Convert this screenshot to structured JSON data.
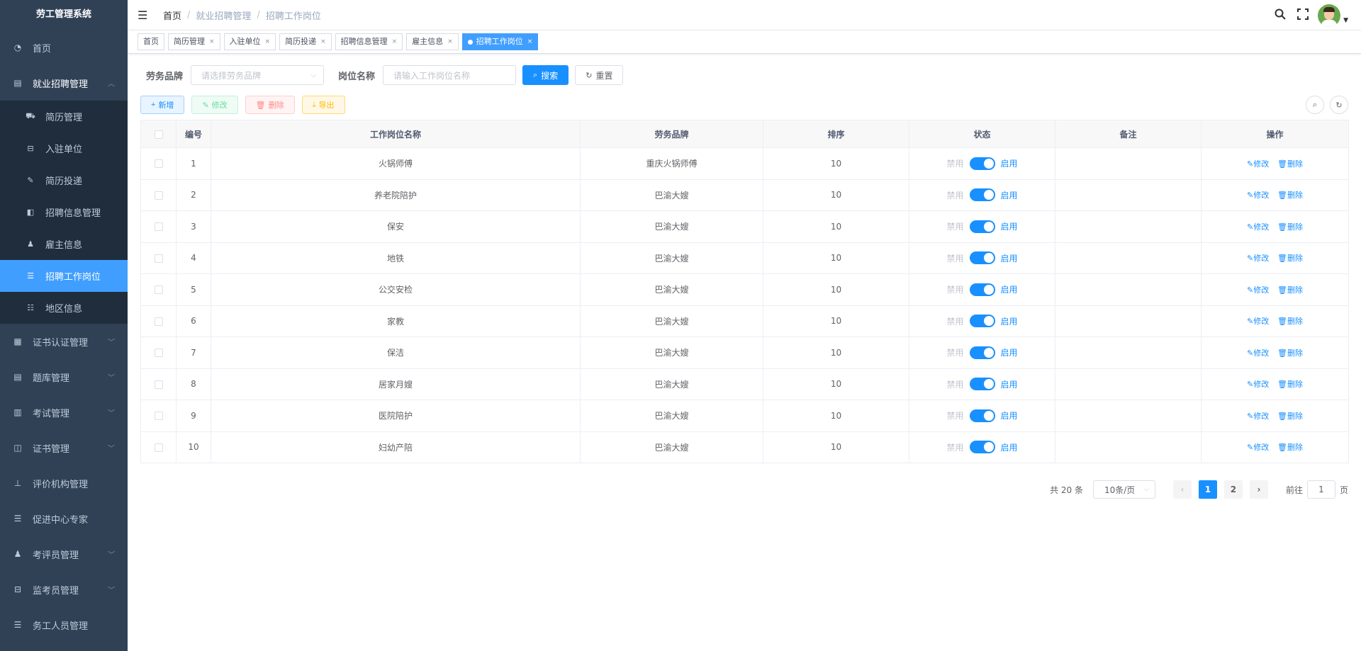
{
  "app": {
    "title": "劳工管理系统"
  },
  "sidebar": {
    "items": [
      {
        "label": "首页",
        "icon": "dashboard-icon",
        "glyph": "◔"
      },
      {
        "label": "就业招聘管理",
        "icon": "document-icon",
        "glyph": "▤",
        "open": true,
        "children": [
          {
            "label": "简历管理",
            "icon": "cart-icon",
            "glyph": "⛟"
          },
          {
            "label": "入驻单位",
            "icon": "building-icon",
            "glyph": "⊟"
          },
          {
            "label": "简历投递",
            "icon": "edit-doc-icon",
            "glyph": "✎"
          },
          {
            "label": "招聘信息管理",
            "icon": "info-icon",
            "glyph": "◧"
          },
          {
            "label": "雇主信息",
            "icon": "people-icon",
            "glyph": "♟"
          },
          {
            "label": "招聘工作岗位",
            "icon": "list-icon",
            "glyph": "☰",
            "active": true
          },
          {
            "label": "地区信息",
            "icon": "tree-list-icon",
            "glyph": "☷"
          }
        ]
      },
      {
        "label": "证书认证管理",
        "icon": "cert-icon",
        "glyph": "▦",
        "arrow": true
      },
      {
        "label": "题库管理",
        "icon": "question-bank-icon",
        "glyph": "▤",
        "arrow": true
      },
      {
        "label": "考试管理",
        "icon": "exam-icon",
        "glyph": "▥",
        "arrow": true
      },
      {
        "label": "证书管理",
        "icon": "book-icon",
        "glyph": "◫",
        "arrow": true
      },
      {
        "label": "评价机构管理",
        "icon": "org-tree-icon",
        "glyph": "⊥"
      },
      {
        "label": "促进中心专家",
        "icon": "list-icon",
        "glyph": "☰"
      },
      {
        "label": "考评员管理",
        "icon": "user-icon",
        "glyph": "♟",
        "arrow": true
      },
      {
        "label": "监考员管理",
        "icon": "building-icon",
        "glyph": "⊟",
        "arrow": true
      },
      {
        "label": "务工人员管理",
        "icon": "list-icon",
        "glyph": "☰"
      }
    ]
  },
  "navbar": {
    "breadcrumb": [
      "首页",
      "就业招聘管理",
      "招聘工作岗位"
    ]
  },
  "tags": [
    {
      "label": "首页",
      "closable": false
    },
    {
      "label": "简历管理",
      "closable": true
    },
    {
      "label": "入驻单位",
      "closable": true
    },
    {
      "label": "简历投递",
      "closable": true
    },
    {
      "label": "招聘信息管理",
      "closable": true
    },
    {
      "label": "雇主信息",
      "closable": true
    },
    {
      "label": "招聘工作岗位",
      "closable": true,
      "active": true
    }
  ],
  "search": {
    "brand_label": "劳务品牌",
    "brand_placeholder": "请选择劳务品牌",
    "job_label": "岗位名称",
    "job_placeholder": "请输入工作岗位名称",
    "search_btn": "搜索",
    "reset_btn": "重置"
  },
  "toolbar": {
    "add": "新增",
    "edit": "修改",
    "delete": "删除",
    "export": "导出"
  },
  "table": {
    "headers": [
      "编号",
      "工作岗位名称",
      "劳务品牌",
      "排序",
      "状态",
      "备注",
      "操作"
    ],
    "switch_off": "禁用",
    "switch_on": "启用",
    "op_edit": "修改",
    "op_delete": "删除",
    "rows": [
      {
        "id": "1",
        "name": "火锅师傅",
        "brand": "重庆火锅师傅",
        "sort": "10",
        "remark": ""
      },
      {
        "id": "2",
        "name": "养老院陪护",
        "brand": "巴渝大嫂",
        "sort": "10",
        "remark": ""
      },
      {
        "id": "3",
        "name": "保安",
        "brand": "巴渝大嫂",
        "sort": "10",
        "remark": ""
      },
      {
        "id": "4",
        "name": "地铁",
        "brand": "巴渝大嫂",
        "sort": "10",
        "remark": ""
      },
      {
        "id": "5",
        "name": "公交安检",
        "brand": "巴渝大嫂",
        "sort": "10",
        "remark": ""
      },
      {
        "id": "6",
        "name": "家教",
        "brand": "巴渝大嫂",
        "sort": "10",
        "remark": ""
      },
      {
        "id": "7",
        "name": "保洁",
        "brand": "巴渝大嫂",
        "sort": "10",
        "remark": ""
      },
      {
        "id": "8",
        "name": "居家月嫂",
        "brand": "巴渝大嫂",
        "sort": "10",
        "remark": ""
      },
      {
        "id": "9",
        "name": "医院陪护",
        "brand": "巴渝大嫂",
        "sort": "10",
        "remark": ""
      },
      {
        "id": "10",
        "name": "妇幼产陪",
        "brand": "巴渝大嫂",
        "sort": "10",
        "remark": ""
      }
    ]
  },
  "pagination": {
    "total": "共 20 条",
    "page_size": "10条/页",
    "pages": [
      "1",
      "2"
    ],
    "current": "1",
    "goto_label": "前往",
    "goto_value": "1",
    "page_suffix": "页"
  },
  "colors": {
    "primary": "#1890ff",
    "sidebar_bg": "#304156",
    "submenu_bg": "#1f2d3d"
  }
}
